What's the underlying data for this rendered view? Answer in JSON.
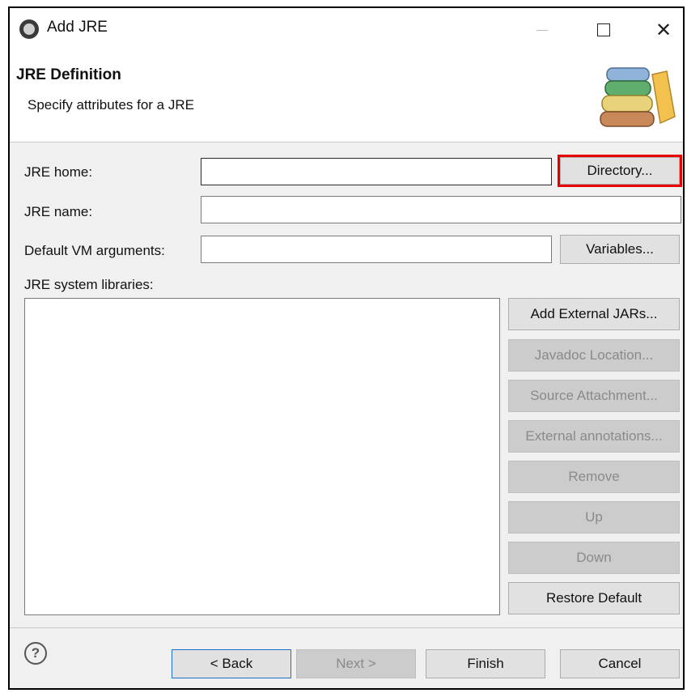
{
  "window": {
    "title": "Add JRE"
  },
  "header": {
    "title": "JRE Definition",
    "subtitle": "Specify attributes for a JRE",
    "icon": "jre-books-icon"
  },
  "form": {
    "jre_home_label": "JRE home:",
    "jre_home_value": "",
    "directory_button": "Directory...",
    "jre_name_label": "JRE name:",
    "jre_name_value": "",
    "vm_args_label": "Default VM arguments:",
    "vm_args_value": "",
    "variables_button": "Variables...",
    "libraries_label": "JRE system libraries:"
  },
  "library_buttons": {
    "add_external_jars": "Add External JARs...",
    "javadoc_location": "Javadoc Location...",
    "source_attachment": "Source Attachment...",
    "external_annotations": "External annotations...",
    "remove": "Remove",
    "up": "Up",
    "down": "Down",
    "restore_default": "Restore Default"
  },
  "footer": {
    "help_icon": "?",
    "back": "< Back",
    "next": "Next >",
    "finish": "Finish",
    "cancel": "Cancel"
  },
  "colors": {
    "highlight": "#e60000",
    "default_button_border": "#1a73c9"
  }
}
